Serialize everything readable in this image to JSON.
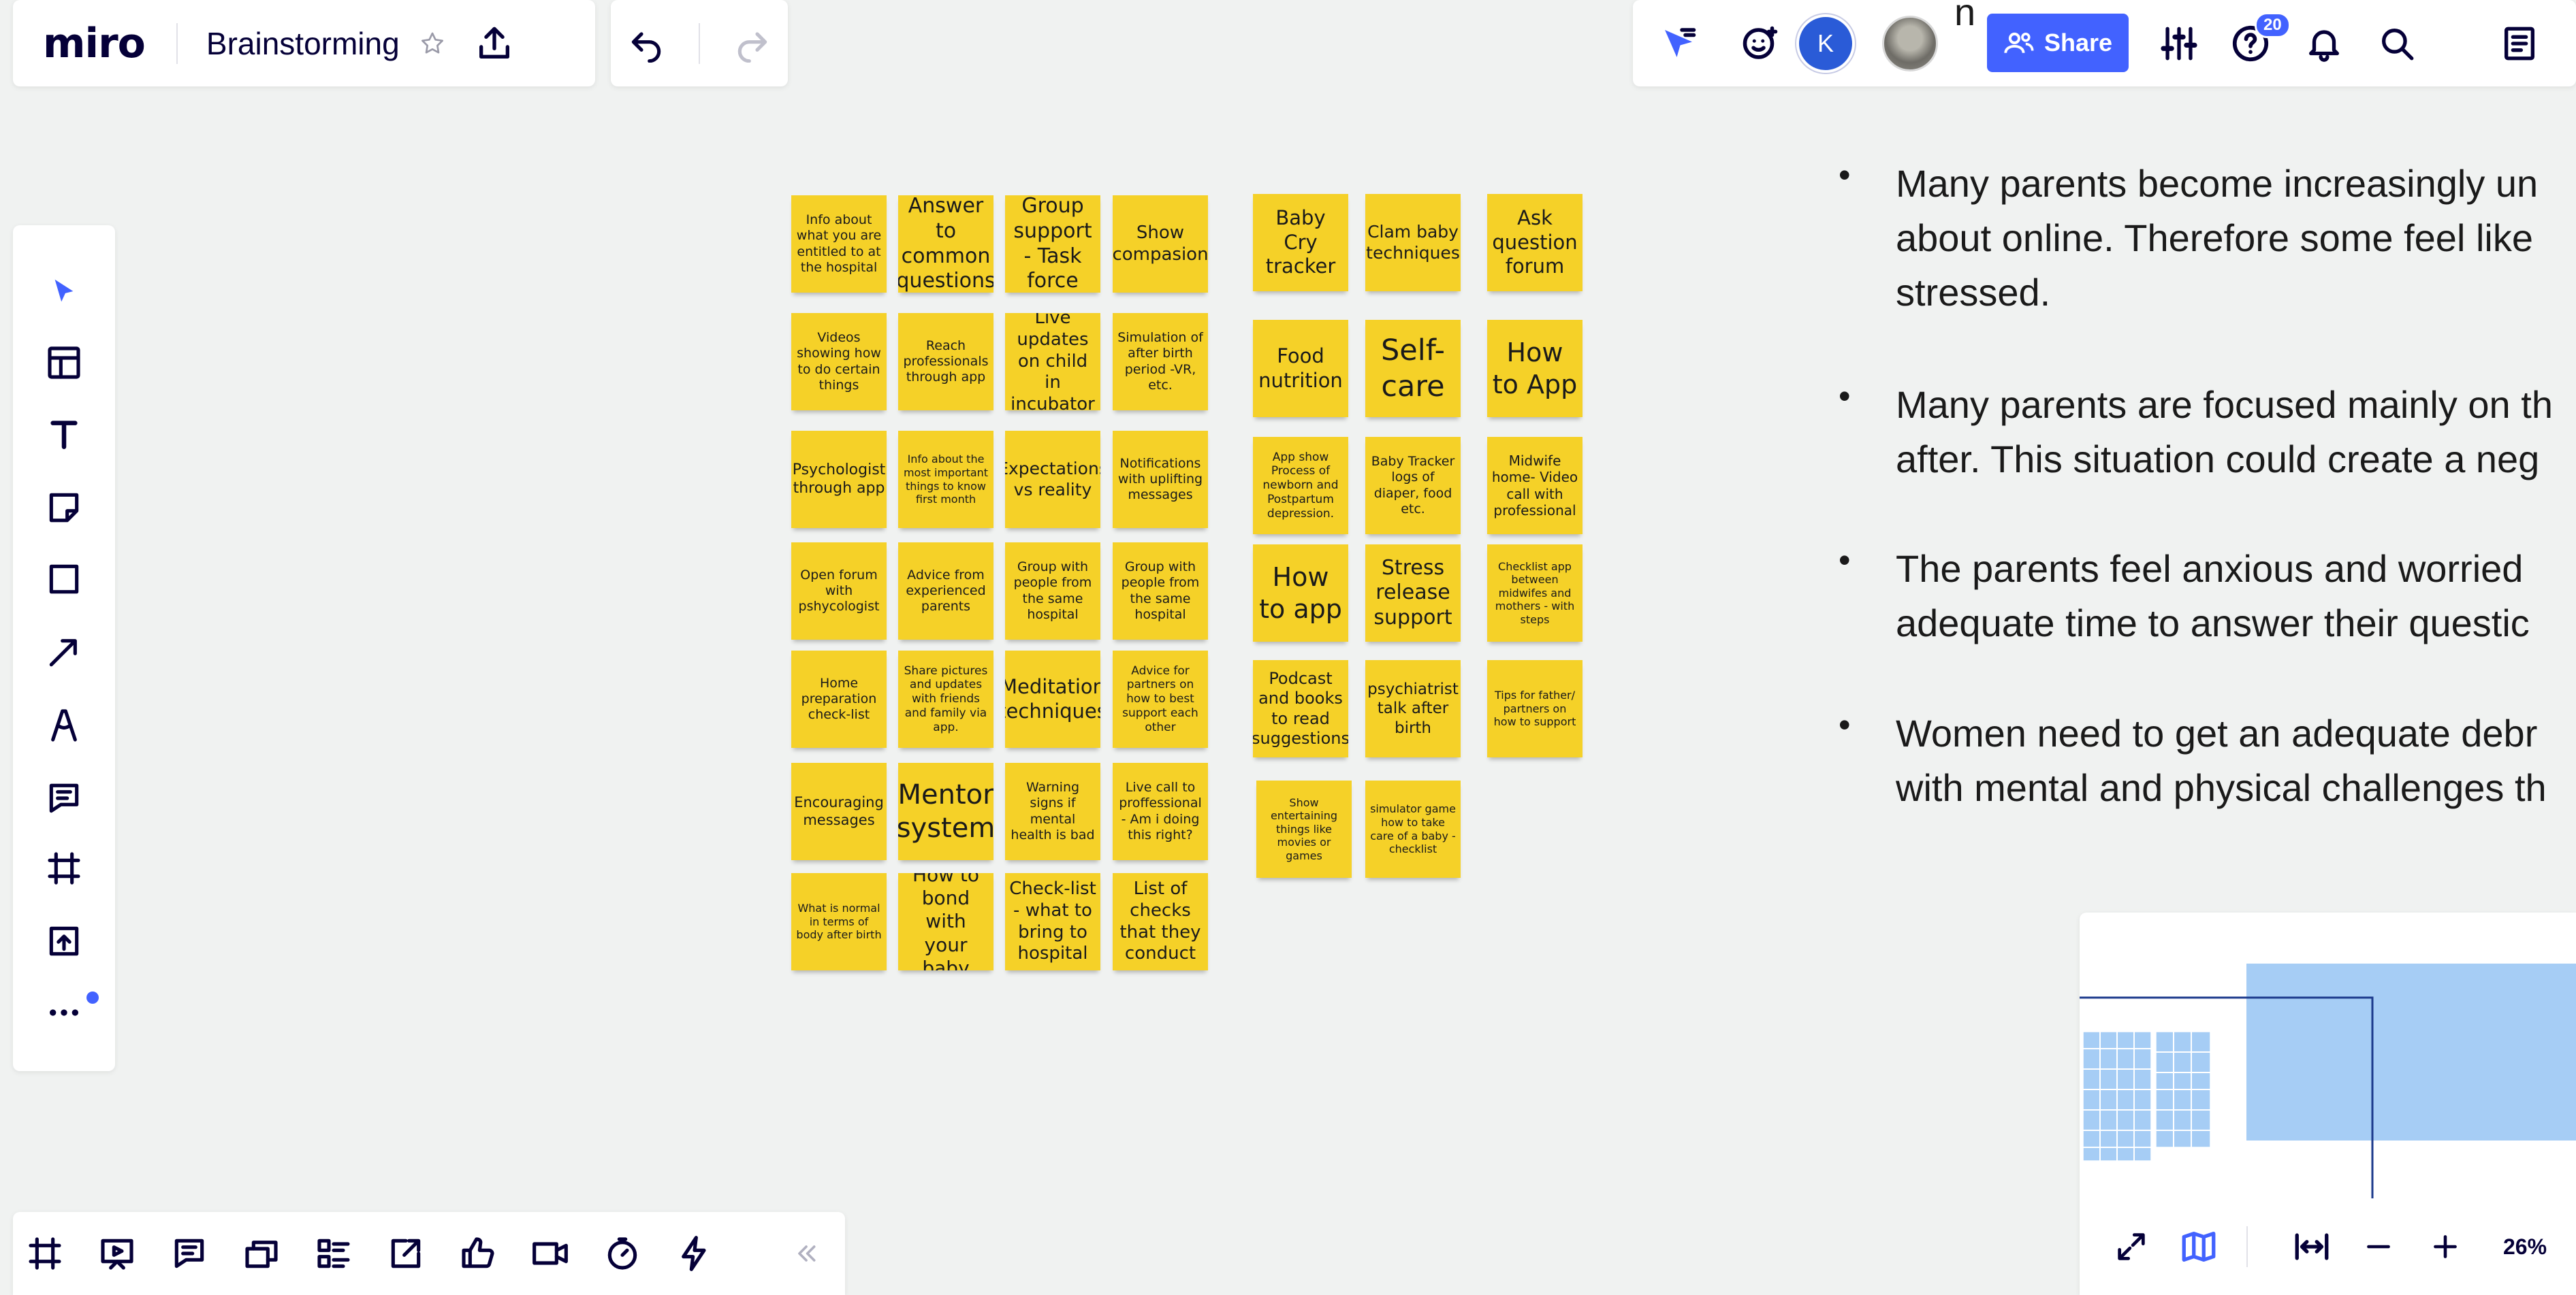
{
  "app": {
    "logo": "miro",
    "board_title": "Brainstorming"
  },
  "header": {
    "share_label": "Share",
    "avatar_initial": "K",
    "help_badge": "20",
    "accent_color": "#4262ff"
  },
  "left_toolbar": {
    "items": [
      "select-icon",
      "templates-icon",
      "text-icon",
      "sticky-note-icon",
      "shape-icon",
      "connection-line-icon",
      "pen-icon",
      "comment-icon",
      "frame-icon",
      "upload-icon",
      "more-icon"
    ]
  },
  "bottom_toolbar": {
    "items": [
      "frames-icon",
      "presentation-icon",
      "comments-icon",
      "cards-icon",
      "kanban-icon",
      "share-screen-icon",
      "voting-icon",
      "video-call-icon",
      "timer-icon",
      "activity-icon",
      "collapse-icon"
    ]
  },
  "stickies": {
    "group1": [
      "Info about what you are entitled to at the hospital",
      "Answer to common questions",
      "Group support - Task force",
      "Show compasion",
      "Videos showing how to do certain things",
      "Reach professionals through app",
      "Live updates on child in incubator",
      "Simulation of after birth period -VR, etc.",
      "Psychologist through app",
      "Info about the most important things to know first month",
      "Expectations vs reality",
      "Notifications with uplifting messages",
      "Open forum with pshycologist",
      "Advice from experienced parents",
      "Group with people from the same hospital",
      "Group with people from the same hospital",
      "Home preparation check-list",
      "Share pictures and updates with friends and family via app.",
      "Meditation techniques",
      "Advice for partners on how to best support each other",
      "Encouraging messages",
      "Mentor system",
      "Warning signs if mental health is bad",
      "Live call to proffessional - Am i doing this right?",
      "What is normal in terms of body after birth",
      "How to bond with your baby",
      "Check-list - what to bring to hospital",
      "List of checks that they conduct"
    ],
    "group2": [
      "Baby Cry tracker",
      "Clam baby techniques",
      "Ask question forum",
      "Food nutrition",
      "Self-care",
      "How to App",
      "App show Process of newborn and Postpartum depression.",
      "Baby Tracker logs of diaper, food etc.",
      "Midwife home- Video call with professional",
      "How to app",
      "Stress release support",
      "Checklist app between midwifes and mothers - with steps",
      "Podcast and books to read suggestions",
      "psychiatrist talk after birth",
      "Tips for father/ partners on how to support",
      "Show entertaining things like movies or games",
      "simulator game how to take care of a baby - checklist"
    ]
  },
  "notes": {
    "lines": [
      "n",
      "Many parents become increasingly un",
      "about online. Therefore some feel like",
      "stressed.",
      "Many parents are focused mainly on th",
      "after. This situation could create a neg",
      "The parents feel anxious and worried",
      "adequate time to answer their questic",
      "Women need to get an adequate debr",
      "with mental and physical challenges th"
    ]
  },
  "minimap": {
    "zoom_level": "26%"
  }
}
